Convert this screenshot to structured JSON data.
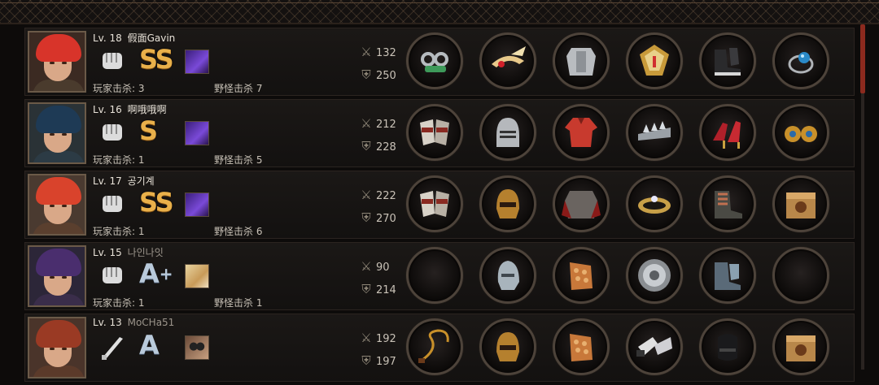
{
  "players": [
    {
      "level": "Lv. 18",
      "name": "假面Gavin",
      "name_dim": false,
      "rank": "SS",
      "rank_style": "gold",
      "rank_plus": "",
      "weapon": "fist-icon",
      "skill": "purple-beast-skill-icon",
      "player_kills": "玩家击杀: 3",
      "monster_kills": "野怪击杀 7",
      "attack": "132",
      "defense": "250",
      "portrait": {
        "hair": "#d8342a",
        "bg": "#3b2a22",
        "body": "#4a3b2d"
      },
      "equipment": [
        "brass-knuckles-icon",
        "winged-tiara-icon",
        "silver-armor-icon",
        "golden-shield-icon",
        "black-boots-icon",
        "blue-gem-ring-icon"
      ]
    },
    {
      "level": "Lv. 16",
      "name": "啊哦哦啊",
      "name_dim": false,
      "rank": "S",
      "rank_style": "gold",
      "rank_plus": "",
      "weapon": "fist-icon",
      "skill": "purple-beast-skill-icon",
      "player_kills": "玩家击杀: 1",
      "monster_kills": "野怪击杀 5",
      "attack": "212",
      "defense": "228",
      "portrait": {
        "hair": "#1e3a55",
        "bg": "#2a3236",
        "body": "#2c3b45"
      },
      "equipment": [
        "armored-gauntlets-icon",
        "knight-helmet-icon",
        "red-shirt-icon",
        "spiked-bracer-icon",
        "red-heels-icon",
        "gold-earrings-icon"
      ]
    },
    {
      "level": "Lv. 17",
      "name": "공기계",
      "name_dim": false,
      "rank": "SS",
      "rank_style": "gold",
      "rank_plus": "",
      "weapon": "fist-icon",
      "skill": "purple-beast-skill-icon",
      "player_kills": "玩家击杀: 1",
      "monster_kills": "野怪击杀 6",
      "attack": "222",
      "defense": "270",
      "portrait": {
        "hair": "#d9432c",
        "bg": "#4a3a30",
        "body": "#5a3f2e"
      },
      "equipment": [
        "armored-gauntlets-icon",
        "bronze-helmet-icon",
        "chainmail-armor-icon",
        "jeweled-bracelet-icon",
        "heavy-boots-icon",
        "mystery-box-icon"
      ]
    },
    {
      "level": "Lv. 15",
      "name": "나인나잇",
      "name_dim": true,
      "rank": "A",
      "rank_style": "silver",
      "rank_plus": "+",
      "weapon": "fist-icon",
      "skill": "bandage-skill-icon",
      "player_kills": "玩家击杀: 1",
      "monster_kills": "野怪击杀 1",
      "attack": "90",
      "defense": "214",
      "portrait": {
        "hair": "#4a2e6e",
        "bg": "#2c2638",
        "body": "#3a2d4a"
      },
      "equipment": [
        "empty-slot-icon",
        "steel-helmet-icon",
        "scale-armor-icon",
        "round-shield-icon",
        "steel-boots-icon",
        "empty-slot-icon"
      ]
    },
    {
      "level": "Lv. 13",
      "name": "MoCHa51",
      "name_dim": true,
      "rank": "A",
      "rank_style": "silver",
      "rank_plus": "",
      "weapon": "baseball-bat-icon",
      "skill": "binoculars-skill-icon",
      "player_kills": "",
      "monster_kills": "",
      "attack": "192",
      "defense": "197",
      "portrait": {
        "hair": "#9a3a24",
        "bg": "#4a342a",
        "body": "#5b3a2a"
      },
      "equipment": [
        "whip-icon",
        "bronze-helmet-icon",
        "scale-armor-icon",
        "white-gauntlets-icon",
        "black-glove-icon",
        "mystery-box-icon"
      ]
    }
  ],
  "colors": {
    "accent": "#e9b04a",
    "frame": "#4d433a",
    "scroll": "#8b2a1e"
  }
}
